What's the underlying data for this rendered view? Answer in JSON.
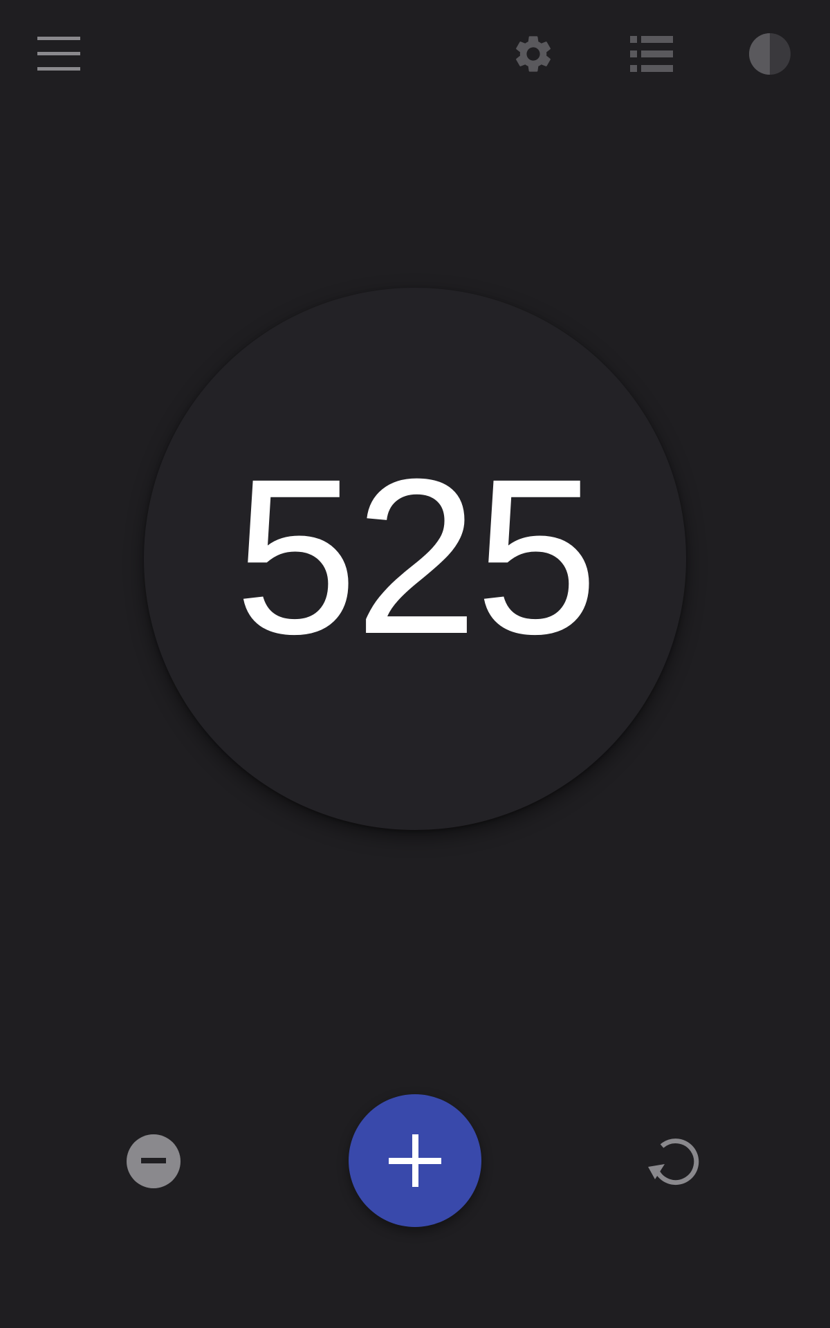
{
  "topbar": {
    "menu_icon": "hamburger-menu-icon",
    "settings_icon": "gear-icon",
    "list_icon": "list-icon",
    "theme_icon": "contrast-icon"
  },
  "counter": {
    "value": "525"
  },
  "controls": {
    "decrement_icon": "minus-circle-icon",
    "increment_icon": "plus-icon",
    "reset_icon": "refresh-icon"
  },
  "colors": {
    "background": "#1f1e21",
    "circle": "#232226",
    "accent": "#3949ab",
    "icon_gray": "#8a898d",
    "icon_dark": "#5a595d"
  }
}
